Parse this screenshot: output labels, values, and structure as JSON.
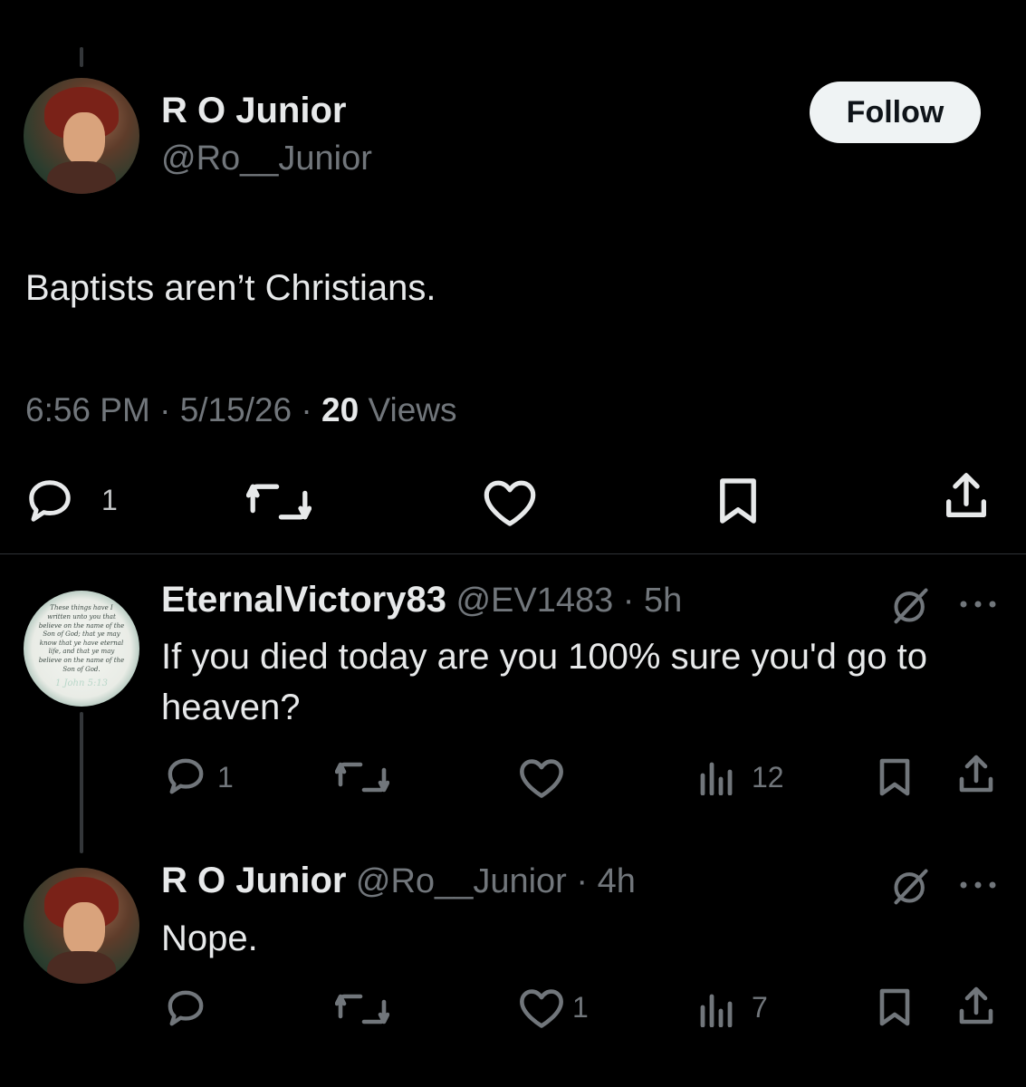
{
  "main_tweet": {
    "author_name": "R O Junior",
    "author_handle": "@Ro__Junior",
    "follow_label": "Follow",
    "text": "Baptists aren’t Christians.",
    "time": "6:56 PM",
    "sep1": " · ",
    "date": "5/15/26",
    "sep2": " · ",
    "views_count": "20",
    "views_label": " Views",
    "actions": {
      "reply_count": "1"
    }
  },
  "replies": [
    {
      "author_name": "EternalVictory83",
      "author_handle": "@EV1483",
      "age": " · 5h",
      "text": "If you died today are you 100% sure you'd go to heaven?",
      "reply_count": "1",
      "like_count": "",
      "views_count": "12",
      "avatar_verse": "These things have I written unto you that believe on the name of the Son of God; that ye may know that ye have eternal life, and that ye may believe on the name of the Son of God.",
      "avatar_ref": "1 John 5:13"
    },
    {
      "author_name": "R O Junior",
      "author_handle": "@Ro__Junior",
      "age": " · 4h",
      "text": "Nope.",
      "reply_count": "",
      "like_count": "1",
      "views_count": "7"
    }
  ],
  "colors": {
    "background": "#000000",
    "text": "#e7e9ea",
    "muted": "#71767b",
    "divider": "#2f3336",
    "follow_bg": "#eff3f4"
  },
  "icons": [
    "reply-icon",
    "retweet-icon",
    "like-icon",
    "bookmark-icon",
    "share-icon",
    "views-icon",
    "grok-icon",
    "more-icon"
  ]
}
